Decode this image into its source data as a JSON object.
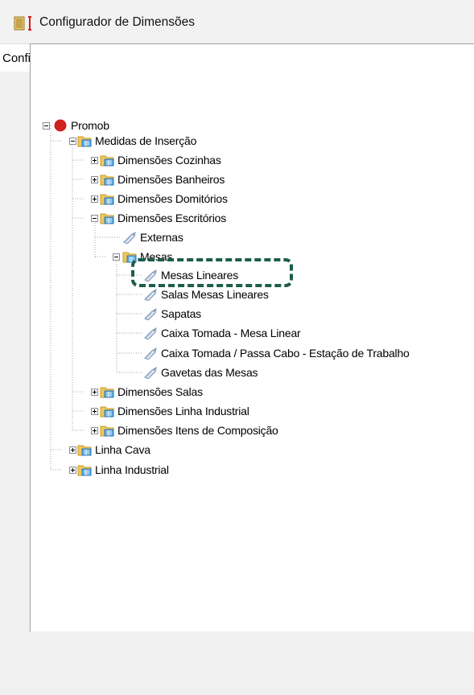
{
  "window": {
    "title": "Configurador de Dimensões"
  },
  "config": {
    "value": "Configuração Padrão"
  },
  "search": {
    "value": "",
    "placeholder": ""
  },
  "tree": {
    "root": "Promob",
    "medidas": "Medidas de Inserção",
    "cozinhas": "Dimensões Cozinhas",
    "banheiros": "Dimensões Banheiros",
    "dormitorios": "Dimensões Domitórios",
    "escritorios": "Dimensões Escritórios",
    "externas": "Externas",
    "mesas": "Mesas",
    "mesas_lineares": "Mesas Lineares",
    "salas_mesas_lineares": "Salas Mesas Lineares",
    "sapatas": "Sapatas",
    "caixa_tomada": "Caixa Tomada - Mesa Linear",
    "caixa_passa_cabo": "Caixa Tomada / Passa Cabo - Estação de Trabalho",
    "gavetas": "Gavetas das Mesas",
    "salas": "Dimensões Salas",
    "linha_industrial_dim": "Dimensões Linha Industrial",
    "itens_composicao": "Dimensões Itens de Composição",
    "linha_cava": "Linha Cava",
    "linha_industrial": "Linha Industrial"
  },
  "colors": {
    "highlight": "#1b5e4a",
    "folder": "#f2c75c",
    "promob_red": "#d02020"
  }
}
